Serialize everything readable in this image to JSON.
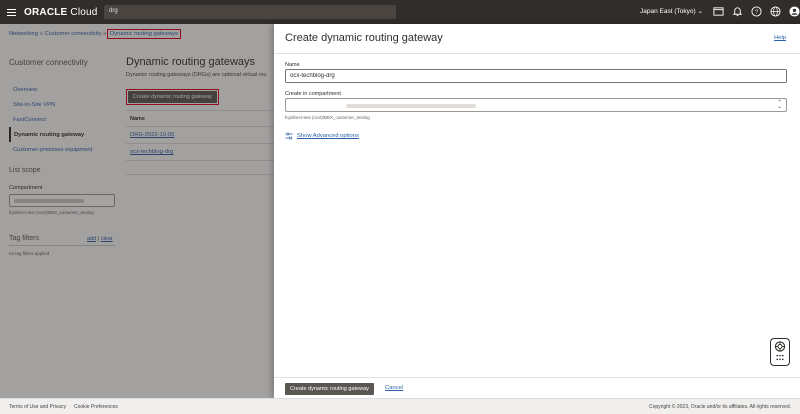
{
  "topbar": {
    "brand_bold": "ORACLE",
    "brand_light": " Cloud",
    "search_value": "drg",
    "region": "Japan East (Tokyo)"
  },
  "breadcrumb": {
    "networking": "Networking",
    "connectivity": "Customer connectivity",
    "current": "Dynamic routing gateways"
  },
  "sidebar": {
    "title": "Customer connectivity",
    "items": [
      {
        "label": "Overview"
      },
      {
        "label": "Site-to-Site VPN"
      },
      {
        "label": "FastConnect"
      },
      {
        "label": "Dynamic routing gateway"
      },
      {
        "label": "Customer-premises equipment"
      }
    ],
    "list_scope": "List scope",
    "compartment_label": "Compartment",
    "compartment_path": "fcpdirect-test (root)/BBX_customer_testing",
    "tag_filters": "Tag filters",
    "add": "add",
    "clear": "clear",
    "no_tags": "no tag filters applied"
  },
  "main": {
    "title": "Dynamic routing gateways",
    "description": "Dynamic routing gateways (DRGs) are optional virtual rou",
    "create_button": "Create dynamic routing gateway",
    "table_header": "Name",
    "rows": [
      "DRG-2022-10-05",
      "ocx-techblog-drg"
    ]
  },
  "panel": {
    "title": "Create dynamic routing gateway",
    "help": "Help",
    "name_label": "Name",
    "name_value": "ocx-techblog-drg",
    "compartment_label": "Create in compartment",
    "compartment_path": "fcpdirect-test (root)/BBX_customer_testing",
    "advanced": "Show Advanced options",
    "create_button": "Create dynamic routing gateway",
    "cancel": "Cancel"
  },
  "footer": {
    "terms": "Terms of Use and Privacy",
    "cookies": "Cookie Preferences",
    "copyright": "Copyright © 2023, Oracle and/or its affiliates. All rights reserved."
  }
}
